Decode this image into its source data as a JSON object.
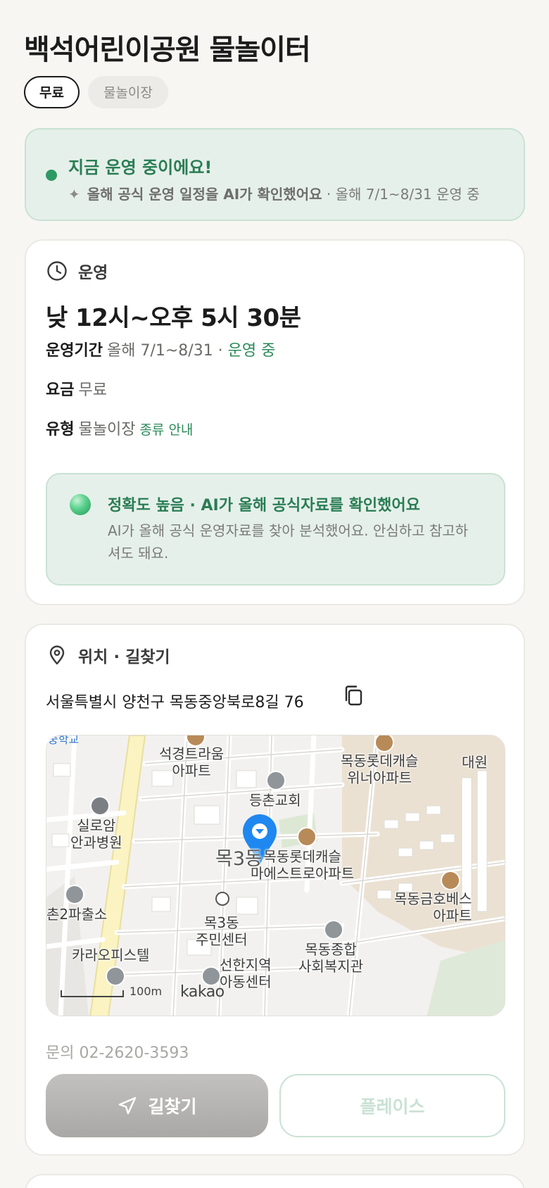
{
  "title": "백석어린이공원 물놀이터",
  "tags": [
    {
      "label": "무료",
      "style": "primary"
    },
    {
      "label": "물놀이장",
      "style": "secondary"
    }
  ],
  "status": {
    "title": "지금 운영 중이에요!",
    "sub_bold": "올해 공식 운영 일정을 AI가 확인했어요",
    "sub_rest": " · 올해 7/1~8/31 운영 중",
    "dot_color": "#2e9a63"
  },
  "hours": {
    "section_label": "운영",
    "main": "낮 12시~오후 5시 30분",
    "period_key": "운영기간",
    "period_value": "올해 7/1~8/31 · ",
    "period_status": "운영 중",
    "fee_key": "요금",
    "fee_value": "무료",
    "type_key": "유형",
    "type_value": "물놀이장",
    "type_link": "종류 안내"
  },
  "ai_box": {
    "title": "정확도 높음 · AI가 올해 공식자료를 확인했어요",
    "desc": "AI가 올해 공식 운영자료를 찾아 분석했어요. 안심하고 참고하셔도 돼요."
  },
  "location": {
    "section_label": "위치 · 길찾기",
    "address": "서울특별시 양천구 목동중앙북로8길 76",
    "phone": "문의 02-2620-3593"
  },
  "map": {
    "labels": {
      "school": "중학교",
      "seokgyeong": "석경트라움\n아파트",
      "lotte_winner": "목동롯데캐슬\n위너아파트",
      "daewon": "대원",
      "deungchon_church": "등촌교회",
      "siloam": "실로암\n안과병원",
      "mok3": "목3동",
      "lotte_maestro": "목동롯데캐슬\n마에스트로아파트",
      "police": "촌2파출소",
      "community": "목3동\n주민센터",
      "geumho": "목동금호베스\n아파트",
      "kara": "카라오피스텔",
      "shinhan": "선한지역\n아동센터",
      "welfare": "목동종합\n사회복지관"
    },
    "scale": "100m",
    "brand": "kakao"
  },
  "buttons": {
    "directions": "길찾기",
    "place": "플레이스"
  }
}
